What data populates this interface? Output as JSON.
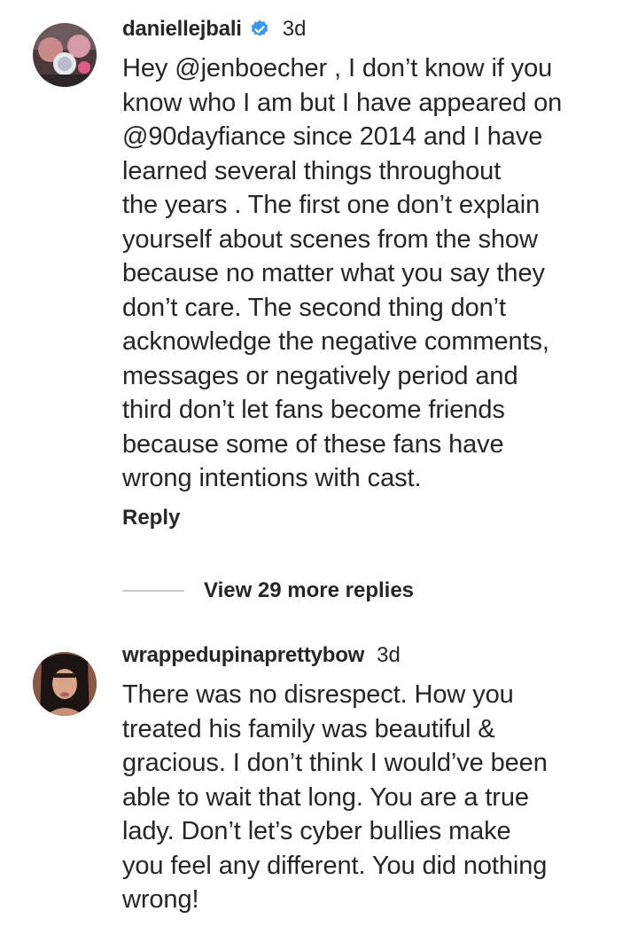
{
  "comments": [
    {
      "username": "daniellejbali",
      "verified": true,
      "time": "3d",
      "text_lines": [
        "Hey @jenboecher , I don’t know if you",
        "know who I am but I have appeared on",
        "@90dayfiance since 2014 and I have",
        "learned several things throughout",
        "the years . The first one don’t explain",
        "yourself about scenes from the show",
        "because no matter what you say they",
        "don’t care. The second thing don’t",
        "acknowledge the negative comments,",
        "messages or negatively period and",
        "third don’t let fans become friends",
        "because some of these fans have",
        "wrong intentions with cast."
      ],
      "reply_label": "Reply",
      "view_replies_label": "View 29 more replies"
    },
    {
      "username": "wrappedupinaprettybow",
      "verified": false,
      "time": "3d",
      "text_lines": [
        "There was no disrespect. How you",
        "treated his family was beautiful &",
        "gracious. I don’t think I would’ve been",
        "able to wait that long. You are a true",
        "lady. Don’t let’s cyber bullies make",
        "you feel any different. You did nothing",
        "wrong!"
      ]
    }
  ],
  "colors": {
    "text": "#262626",
    "verified_badge": "#3897f0",
    "divider": "#c7c7c7"
  }
}
